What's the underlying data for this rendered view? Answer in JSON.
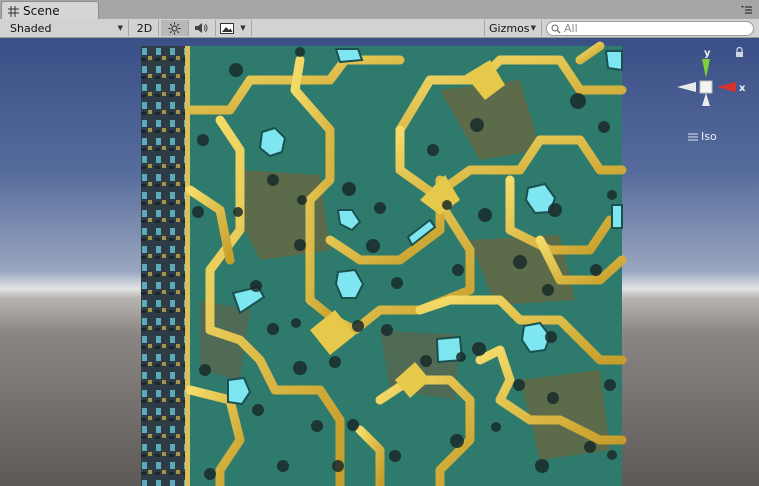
{
  "window": {
    "tab_title": "Scene",
    "tab_icon": "grid-icon",
    "menu_icon": "window-menu-icon"
  },
  "toolbar": {
    "shading_mode": "Shaded",
    "mode_2d_label": "2D",
    "lighting_icon": "sun-icon",
    "audio_icon": "speaker-icon",
    "effects_icon": "image-icon",
    "gizmos_label": "Gizmos",
    "search_placeholder": "All"
  },
  "scene": {
    "gizmo": {
      "y_label": "y",
      "x_label": "x",
      "projection_label": "Iso",
      "y_axis_color": "#7fcf3a",
      "x_axis_color": "#d8322d"
    },
    "colors": {
      "sky_top": "#3a4f86",
      "horizon": "#e3e3e3",
      "ground": "#5d5957",
      "tile_teal": "#2e7a6d",
      "trace_gold": "#e3c347",
      "light_cyan": "#7ee6f0"
    }
  }
}
